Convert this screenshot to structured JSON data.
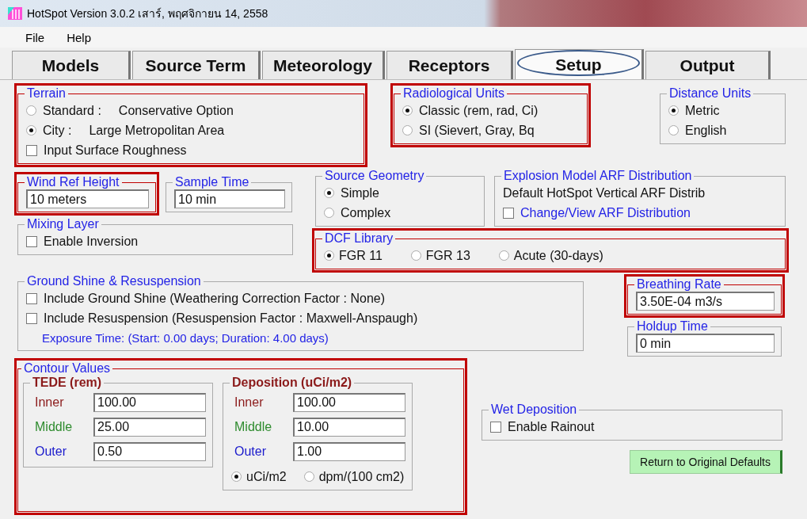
{
  "window": {
    "title": "HotSpot Version 3.0.2 เสาร์, พฤศจิกายน 14, 2558"
  },
  "menu": [
    {
      "label": "File"
    },
    {
      "label": "Help"
    }
  ],
  "tabs": [
    {
      "label": "Models",
      "selected": false,
      "circled": false
    },
    {
      "label": "Source Term",
      "selected": false,
      "circled": false
    },
    {
      "label": "Meteorology",
      "selected": false,
      "circled": false
    },
    {
      "label": "Receptors",
      "selected": false,
      "circled": false
    },
    {
      "label": "Setup",
      "selected": true,
      "circled": true
    },
    {
      "label": "Output",
      "selected": false,
      "circled": false
    }
  ],
  "terrain": {
    "legend": "Terrain",
    "highlighted": true,
    "items": [
      {
        "kind": "radio",
        "label": "Standard :",
        "detail": "Conservative Option",
        "selected": false
      },
      {
        "kind": "radio",
        "label": "City :",
        "detail": "Large Metropolitan Area",
        "selected": true
      },
      {
        "kind": "checkbox",
        "label": "Input Surface Roughness",
        "checked": false
      }
    ]
  },
  "radiological_units": {
    "legend": "Radiological Units",
    "highlighted": true,
    "items": [
      {
        "kind": "radio",
        "label": "Classic (rem, rad, Ci)",
        "selected": true
      },
      {
        "kind": "radio",
        "label": "SI (Sievert,  Gray, Bq",
        "selected": false
      }
    ]
  },
  "distance_units": {
    "legend": "Distance Units",
    "items": [
      {
        "kind": "radio",
        "label": "Metric",
        "selected": true
      },
      {
        "kind": "radio",
        "label": "English",
        "selected": false
      }
    ]
  },
  "wind_ref_height": {
    "legend": "Wind Ref Height",
    "highlighted": true,
    "items": [
      {
        "kind": "field",
        "value": "10 meters"
      }
    ]
  },
  "sample_time": {
    "legend": "Sample Time",
    "items": [
      {
        "kind": "field",
        "value": "10 min"
      }
    ]
  },
  "mixing_layer": {
    "legend": "Mixing Layer",
    "items": [
      {
        "kind": "checkbox",
        "label": "Enable Inversion",
        "checked": false
      }
    ]
  },
  "source_geometry": {
    "legend": "Source Geometry",
    "items": [
      {
        "kind": "radio",
        "label": "Simple",
        "selected": true
      },
      {
        "kind": "radio",
        "label": "Complex",
        "selected": false
      }
    ]
  },
  "explosion_model": {
    "legend": "Explosion Model ARF Distribution",
    "items": [
      {
        "kind": "text",
        "text": "Default HotSpot Vertical ARF Distrib"
      },
      {
        "kind": "action",
        "label": "Change/View ARF Distribution",
        "checked": false
      }
    ]
  },
  "dcf_library": {
    "legend": "DCF Library",
    "highlighted": true,
    "items": [
      {
        "kind": "radio",
        "label": "FGR 11",
        "selected": true
      },
      {
        "kind": "radio",
        "label": "FGR 13",
        "selected": false
      },
      {
        "kind": "radio",
        "label": "Acute (30-days)",
        "selected": false
      }
    ]
  },
  "ground_shine": {
    "legend": "Ground Shine & Resuspension",
    "items": [
      {
        "kind": "checkbox",
        "label": "Include Ground Shine (Weathering Correction Factor : None)",
        "checked": false
      },
      {
        "kind": "checkbox",
        "label": "Include Resuspension (Resuspension Factor : Maxwell-Anspaugh)",
        "checked": false
      },
      {
        "kind": "note",
        "text": "Exposure Time: (Start: 0.00 days; Duration: 4.00 days)"
      }
    ]
  },
  "breathing_rate": {
    "legend": "Breathing Rate",
    "highlighted": true,
    "items": [
      {
        "kind": "field",
        "value": "3.50E-04  m3/s"
      }
    ]
  },
  "holdup_time": {
    "legend": "Holdup Time",
    "items": [
      {
        "kind": "field",
        "value": "0 min"
      }
    ]
  },
  "contour_values": {
    "legend": "Contour Values",
    "highlighted": true,
    "tede": {
      "legend": "TEDE (rem)",
      "rows": [
        {
          "label": "Inner",
          "value": "100.00",
          "color": "#8b1a1a"
        },
        {
          "label": "Middle",
          "value": "25.00",
          "color": "#2e8b2e"
        },
        {
          "label": "Outer",
          "value": "0.50",
          "color": "#1a1acc"
        }
      ]
    },
    "deposition": {
      "legend": "Deposition (uCi/m2)",
      "rows": [
        {
          "label": "Inner",
          "value": "100.00",
          "color": "#8b1a1a"
        },
        {
          "label": "Middle",
          "value": "10.00",
          "color": "#2e8b2e"
        },
        {
          "label": "Outer",
          "value": "1.00",
          "color": "#1a1acc"
        }
      ],
      "units": [
        {
          "kind": "radio",
          "label": "uCi/m2",
          "selected": true
        },
        {
          "kind": "radio",
          "label": "dpm/(100 cm2)",
          "selected": false
        }
      ]
    }
  },
  "wet_deposition": {
    "legend": "Wet Deposition",
    "items": [
      {
        "kind": "checkbox",
        "label": "Enable Rainout",
        "checked": false
      }
    ]
  },
  "defaults_button": {
    "label": "Return to Original Defaults"
  }
}
